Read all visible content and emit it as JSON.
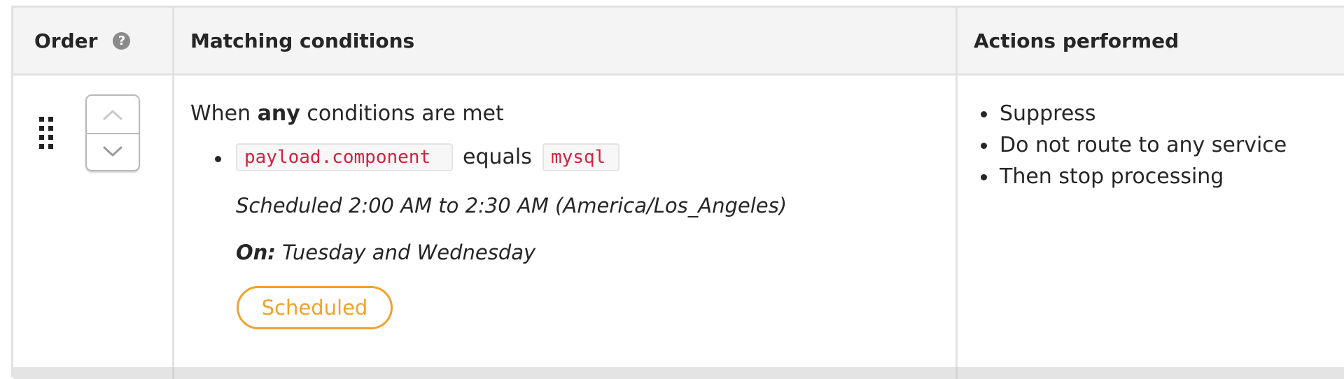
{
  "table": {
    "headers": {
      "order": "Order",
      "matching": "Matching conditions",
      "actions": "Actions performed"
    },
    "help_icon_glyph": "?",
    "rule": {
      "condition_prefix": "When ",
      "condition_keyword": "any",
      "condition_suffix": " conditions are met",
      "condition": {
        "field": "payload.component",
        "operator": "equals",
        "value": "mysql"
      },
      "schedule": "Scheduled 2:00 AM to 2:30 AM (America/Los_Angeles)",
      "on_label": "On:",
      "on_days": " Tuesday and Wednesday",
      "status": "Scheduled",
      "actions": [
        "Suppress",
        "Do not route to any service",
        "Then stop processing"
      ]
    }
  },
  "icons": {
    "help": "question-circle-icon",
    "drag": "drag-handle-icon",
    "up": "chevron-up-icon",
    "down": "chevron-down-icon"
  },
  "colors": {
    "code_text": "#d1223f",
    "status": "#f0a22a",
    "header_bg": "#f4f4f4",
    "border": "#e2e2e2"
  }
}
